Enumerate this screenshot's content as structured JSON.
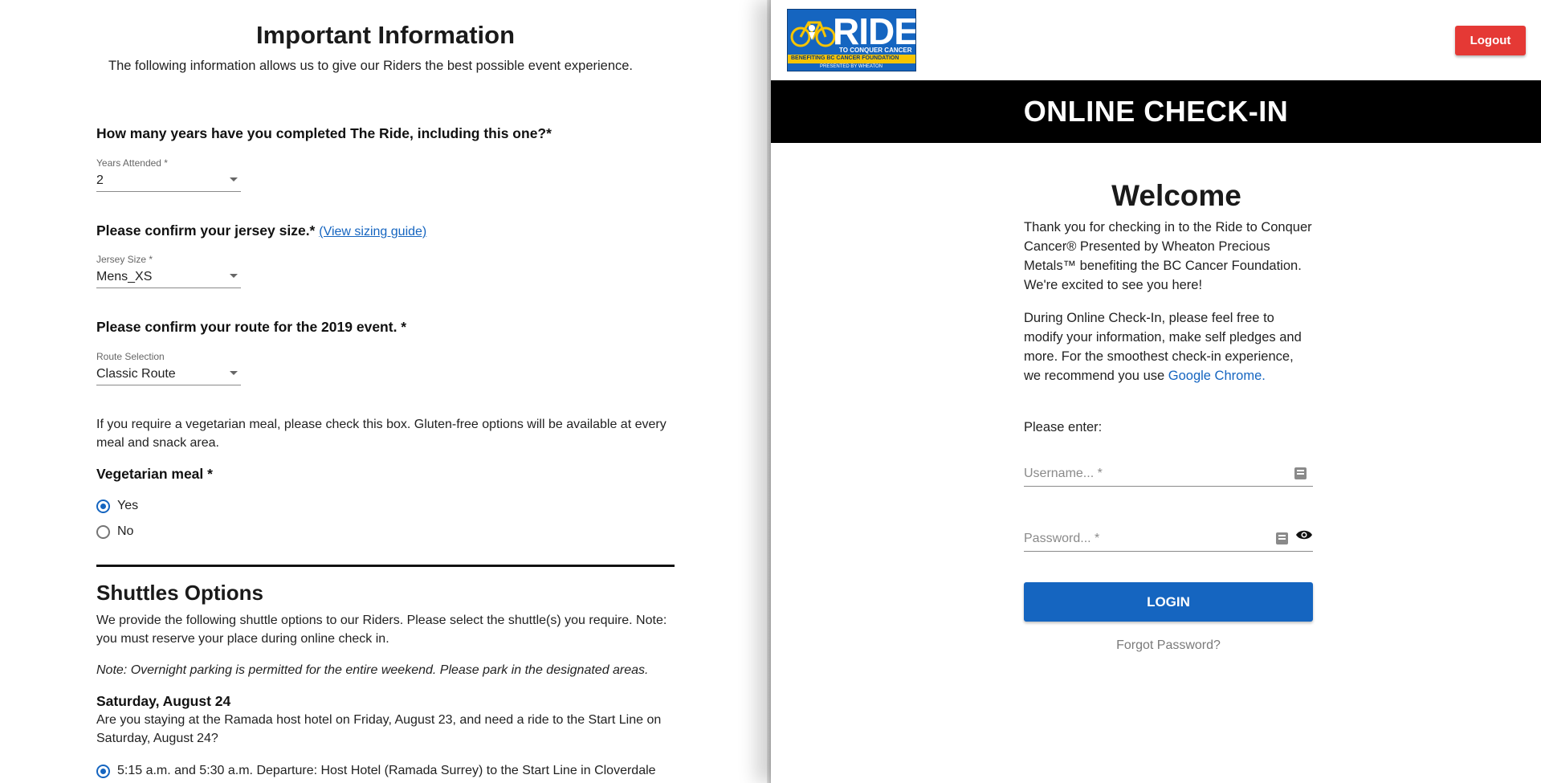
{
  "info": {
    "title": "Important Information",
    "intro": "The following information allows us to give our Riders the best possible event experience.",
    "years_question": "How many years have you completed The Ride, including this one?*",
    "years_label": "Years Attended *",
    "years_value": "2",
    "jersey_question": "Please confirm your jersey size.*",
    "jersey_link": "(View sizing guide)",
    "jersey_label": "Jersey Size *",
    "jersey_value": "Mens_XS",
    "route_question": "Please confirm your route for the 2019 event. *",
    "route_label": "Route Selection",
    "route_value": "Classic Route",
    "meal_note": "If you require a vegetarian meal, please check this box. Gluten-free options will be available at every meal and snack area.",
    "meal_question": "Vegetarian meal *",
    "meal_options": [
      "Yes",
      "No"
    ],
    "meal_selected": "Yes"
  },
  "shuttles": {
    "title": "Shuttles Options",
    "intro": "We provide the following shuttle options to our Riders. Please select the shuttle(s) you require. Note: you must reserve your place during online check in.",
    "note": "Note: Overnight parking is permitted for the entire weekend. Please park in the designated areas.",
    "day_heading": "Saturday, August 24",
    "day_question": "Are you staying at the Ramada host hotel on Friday, August 23, and need a ride to the Start Line on Saturday, August 24?",
    "option_1": "5:15 a.m. and 5:30 a.m. Departure: Host Hotel (Ramada Surrey) to the Start Line in Cloverdale"
  },
  "header": {
    "logo_main": "RIDE",
    "logo_sub1": "TO CONQUER CANCER",
    "logo_sub2": "BENEFITING BC CANCER FOUNDATION",
    "logo_sub3": "PRESENTED BY WHEATON",
    "logout_label": "Logout",
    "banner": "ONLINE CHECK-IN"
  },
  "login": {
    "welcome": "Welcome",
    "para1": "Thank you for checking in to the Ride to Conquer Cancer® Presented by Wheaton Precious Metals™ benefiting the BC Cancer Foundation. We're excited to see you here!",
    "para2_text": "During Online Check-In, please feel free to modify your information, make self pledges and more. For the smoothest check-in experience, we recommend you use ",
    "para2_link": "Google Chrome.",
    "prompt": "Please enter:",
    "username_placeholder": "Username... *",
    "password_placeholder": "Password... *",
    "login_label": "LOGIN",
    "forgot_label": "Forgot Password?"
  },
  "colors": {
    "primary": "#1565c0",
    "logout": "#e53935",
    "banner": "#000000",
    "logo_band": "#f7c400"
  },
  "icons": [
    "chevron-down-icon",
    "radio-icon",
    "key-icon",
    "eye-icon",
    "bicycle-icon"
  ]
}
